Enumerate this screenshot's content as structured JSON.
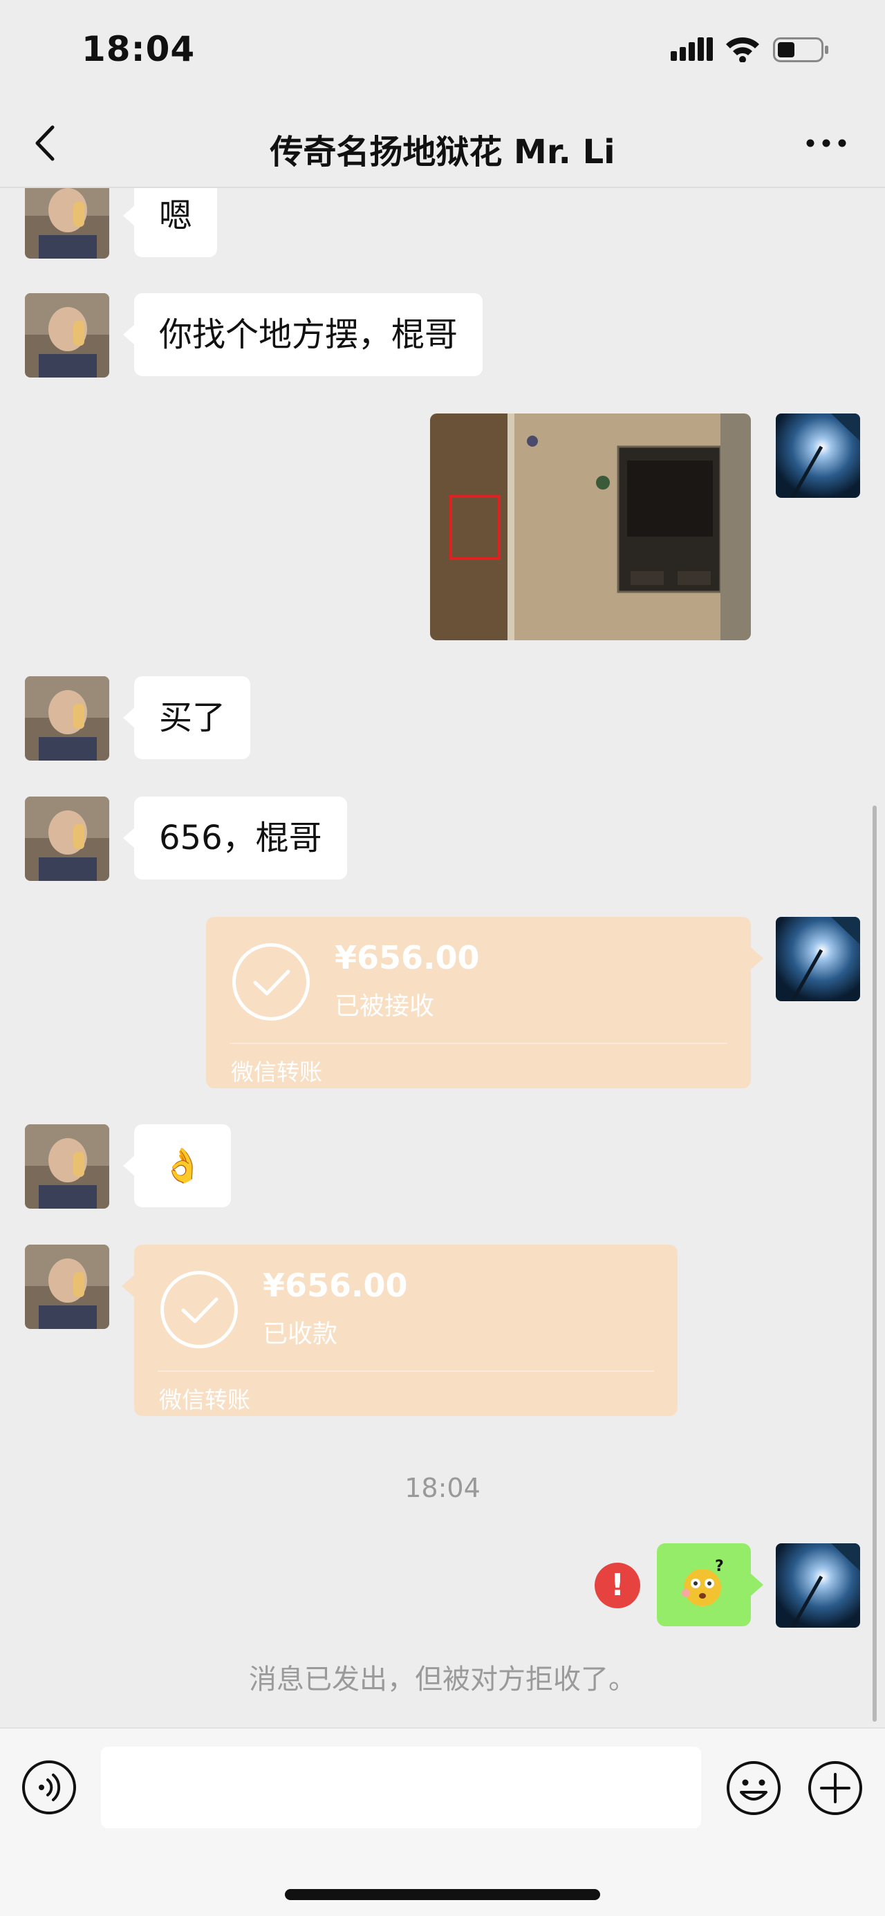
{
  "status_bar": {
    "time": "18:04"
  },
  "nav": {
    "title": "传奇名扬地狱花 Mr. Li"
  },
  "messages": {
    "m1": {
      "text": "嗯"
    },
    "m2": {
      "text": "你找个地方摆，棍哥"
    },
    "m4": {
      "text": "买了"
    },
    "m5": {
      "text": "656，棍哥"
    },
    "t1": {
      "amount": "¥656.00",
      "status": "已被接收",
      "label": "微信转账"
    },
    "m7": {
      "text": "👌"
    },
    "t2": {
      "amount": "¥656.00",
      "status": "已收款",
      "label": "微信转账"
    }
  },
  "timestamp": "18:04",
  "system_note": "消息已发出，但被对方拒收了。",
  "colors": {
    "background": "#ededed",
    "transfer": "#f8dfc3",
    "sent_bubble": "#95ec69",
    "error": "#e64340"
  }
}
